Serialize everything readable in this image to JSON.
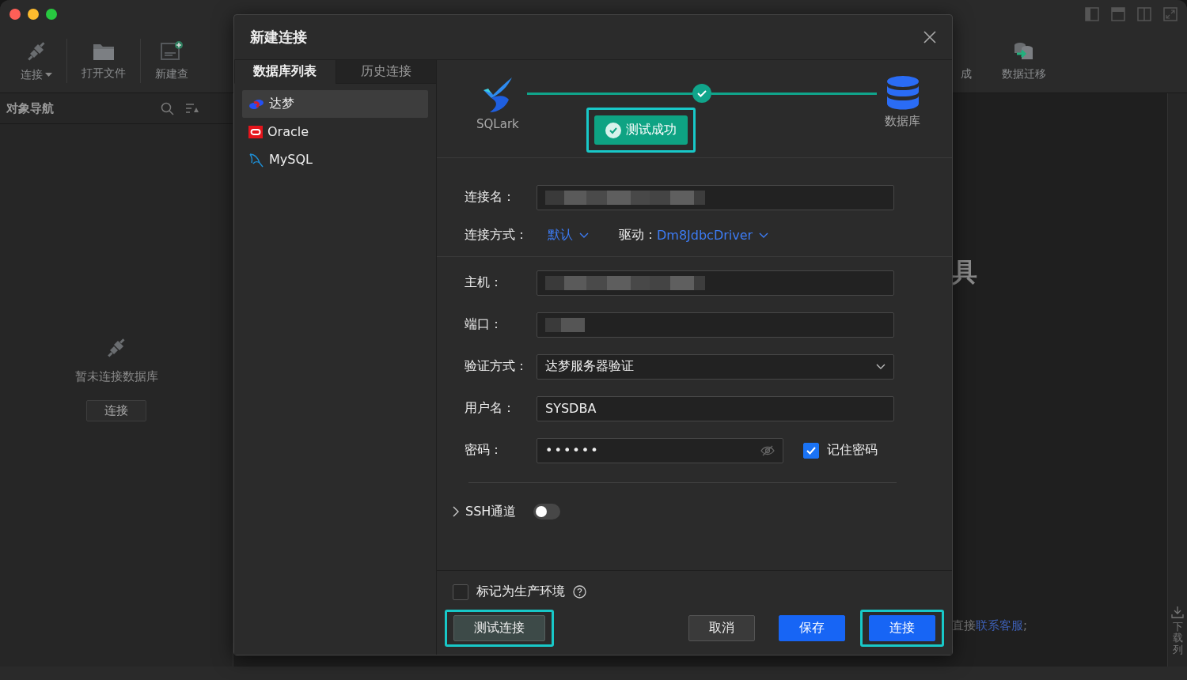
{
  "toolbar": {
    "left": [
      {
        "label": "连接",
        "kind": "plug",
        "dropdown": true
      },
      {
        "label": "打开文件",
        "kind": "folder",
        "dropdown": false
      },
      {
        "label": "新建查",
        "kind": "sql",
        "dropdown": false
      }
    ],
    "right": [
      {
        "label": "成",
        "kind": "none",
        "dropdown": false
      },
      {
        "label": "数据迁移",
        "kind": "migrate",
        "dropdown": false
      }
    ]
  },
  "sidebar": {
    "title": "对象导航",
    "empty_message": "暂未连接数据库",
    "button": "连接"
  },
  "main": {
    "heading": "具",
    "footer_text": "直接",
    "footer_link": "联系客服",
    "footer_end": ";"
  },
  "download_panel": {
    "label": "下载列"
  },
  "dialog": {
    "title": "新建连接",
    "tabs": [
      {
        "label": "数据库列表",
        "selected": true
      },
      {
        "label": "历史连接",
        "selected": false
      }
    ],
    "databases": [
      {
        "name": "达梦",
        "kind": "dameng",
        "selected": true
      },
      {
        "name": "Oracle",
        "kind": "oracle",
        "selected": false
      },
      {
        "name": "MySQL",
        "kind": "mysql",
        "selected": false
      }
    ],
    "steps": {
      "source": "SQLark",
      "target": "数据库",
      "status": "测试成功",
      "highlighted": true
    },
    "name_field": {
      "label": "连接名：",
      "redacted": true
    },
    "connection_mode": {
      "label": "连接方式：",
      "value": "默认"
    },
    "driver": {
      "label": "驱动：",
      "value": "Dm8JdbcDriver"
    },
    "fields": [
      {
        "label": "主机：",
        "kind": "redacted"
      },
      {
        "label": "端口：",
        "kind": "redacted_short"
      },
      {
        "label": "验证方式：",
        "kind": "select",
        "value": "达梦服务器验证"
      },
      {
        "label": "用户名：",
        "kind": "text",
        "value": "SYSDBA"
      },
      {
        "label": "密码：",
        "kind": "password",
        "value": "••••••"
      }
    ],
    "remember_password": {
      "label": "记住密码",
      "checked": true
    },
    "ssh": {
      "label": "SSH通道",
      "expanded": false,
      "on": false
    },
    "production": {
      "label": "标记为生产环境",
      "checked": false
    },
    "buttons": [
      {
        "label": "测试连接",
        "kind": "test",
        "highlighted": true
      },
      {
        "label": "取消",
        "kind": "secondary",
        "highlighted": false
      },
      {
        "label": "保存",
        "kind": "primary",
        "highlighted": false
      },
      {
        "label": "连接",
        "kind": "primary",
        "highlighted": true
      }
    ]
  }
}
